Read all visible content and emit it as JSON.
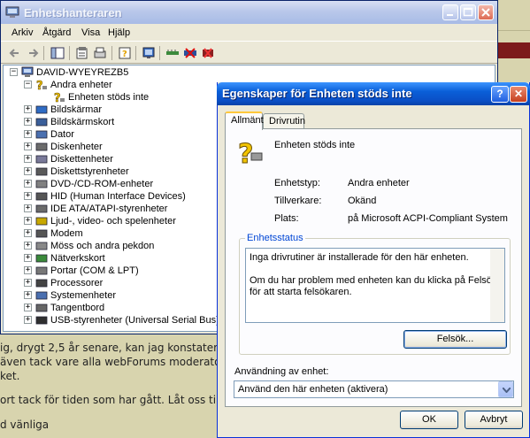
{
  "background": {
    "lines": [
      "ig, drygt 2,5 år senare, kan jag konstater",
      "även tack vare alla webForums moderator",
      "ket.",
      "ort tack för tiden som har gått. Låt oss til",
      "d vänliga"
    ]
  },
  "device_manager": {
    "title": "Enhetshanteraren",
    "menu": [
      "Arkiv",
      "Åtgärd",
      "Visa",
      "Hjälp"
    ],
    "toolbar_icons": [
      "back-icon",
      "forward-icon",
      "show-hide-console-tree-icon",
      "properties-icon",
      "help-icon",
      "scan-hardware-icon",
      "update-driver-icon",
      "disable-icon",
      "uninstall-icon"
    ],
    "tree": {
      "root": "DAVID-WYEYREZB5",
      "expanded_category": "Andra enheter",
      "expanded_child": "Enheten stöds inte",
      "categories": [
        "Bildskärmar",
        "Bildskärmskort",
        "Dator",
        "Diskenheter",
        "Diskettenheter",
        "Diskettstyrenheter",
        "DVD-/CD-ROM-enheter",
        "HID (Human Interface Devices)",
        "IDE ATA/ATAPI-styrenheter",
        "Ljud-, video- och spelenheter",
        "Modem",
        "Möss och andra pekdon",
        "Nätverkskort",
        "Portar (COM & LPT)",
        "Processorer",
        "Systemenheter",
        "Tangentbord",
        "USB-styrenheter (Universal Serial Bus)"
      ]
    }
  },
  "dialog": {
    "title": "Egenskaper för Enheten stöds inte",
    "help_button": "?",
    "close_button": "✕",
    "tabs": [
      "Allmänt",
      "Drivrutin"
    ],
    "device_name": "Enheten stöds inte",
    "properties": [
      {
        "label": "Enhetstyp:",
        "value": "Andra enheter"
      },
      {
        "label": "Tillverkare:",
        "value": "Okänd"
      },
      {
        "label": "Plats:",
        "value": "på Microsoft ACPI-Compliant System"
      }
    ],
    "status_group": "Enhetsstatus",
    "status_line1": "Inga drivrutiner är installerade för den här enheten.",
    "status_line2": "Om du har problem med enheten kan du klicka på Felsök för att starta felsökaren.",
    "troubleshoot_button": "Felsök...",
    "usage_label": "Användning av enhet:",
    "usage_value": "Använd den här enheten (aktivera)",
    "ok_button": "OK",
    "cancel_button": "Avbryt"
  }
}
